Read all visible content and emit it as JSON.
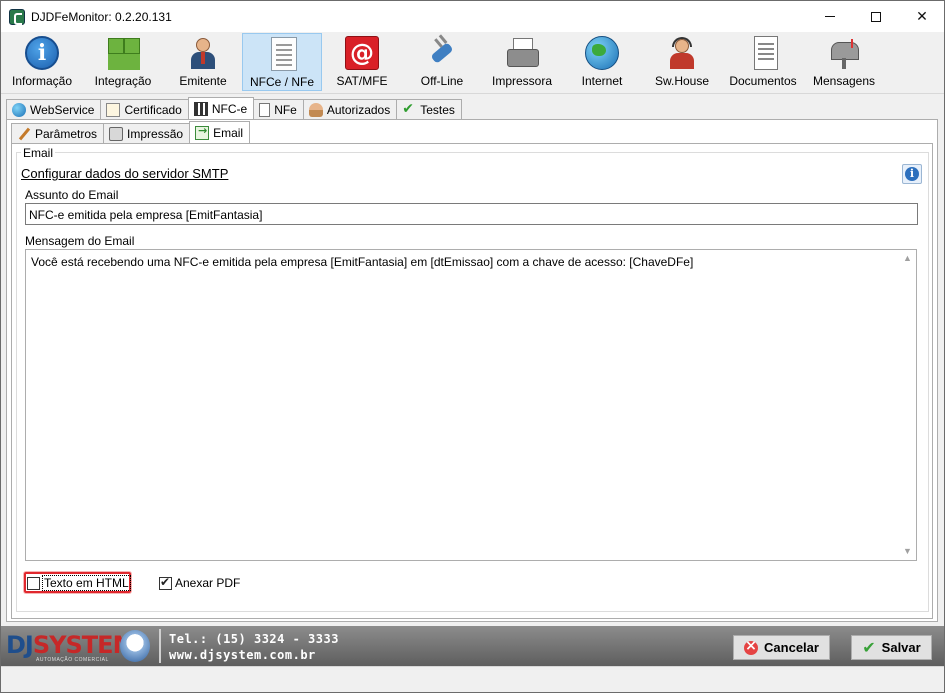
{
  "window": {
    "title": "DJDFeMonitor: 0.2.20.131"
  },
  "toolbar": {
    "buttons": [
      {
        "label": "Informação",
        "icon": "info-icon"
      },
      {
        "label": "Integração",
        "icon": "integration-icon"
      },
      {
        "label": "Emitente",
        "icon": "person-icon"
      },
      {
        "label": "NFCe / NFe",
        "icon": "receipt-icon",
        "active": true
      },
      {
        "label": "SAT/MFE",
        "icon": "at-sign-icon"
      },
      {
        "label": "Off-Line",
        "icon": "plug-icon"
      },
      {
        "label": "Impressora",
        "icon": "printer-icon"
      },
      {
        "label": "Internet",
        "icon": "globe-icon"
      },
      {
        "label": "Sw.House",
        "icon": "support-agent-icon"
      },
      {
        "label": "Documentos",
        "icon": "document-icon"
      },
      {
        "label": "Mensagens",
        "icon": "mailbox-icon"
      }
    ]
  },
  "tabs_main": [
    "WebService",
    "Certificado",
    "NFC-e",
    "NFe",
    "Autorizados",
    "Testes"
  ],
  "tabs_sub": [
    "Parâmetros",
    "Impressão",
    "Email"
  ],
  "email": {
    "group_label": "Email",
    "smtp_link": "Configurar dados do servidor SMTP",
    "subject_label": "Assunto do Email",
    "subject_value": "NFC-e emitida pela empresa [EmitFantasia]",
    "message_label": "Mensagem do Email",
    "message_value": "Você está recebendo uma NFC-e emitida pela empresa [EmitFantasia] em [dtEmissao] com a chave de acesso: [ChaveDFe]",
    "html_checkbox_label": "Texto em HTML",
    "html_checked": false,
    "pdf_checkbox_label": "Anexar PDF",
    "pdf_checked": true
  },
  "footer": {
    "brand_dj": "DJ",
    "brand_system": "SYSTEM",
    "brand_sub": "AUTOMAÇÃO COMERCIAL",
    "phone": "Tel.: (15) 3324 - 3333",
    "website": "www.djsystem.com.br",
    "cancel_label": "Cancelar",
    "save_label": "Salvar"
  },
  "colors": {
    "active_toolbar": "#cce4f7",
    "highlight": "#e0282e",
    "brand_blue": "#1f4e8c",
    "brand_red": "#c62828"
  }
}
